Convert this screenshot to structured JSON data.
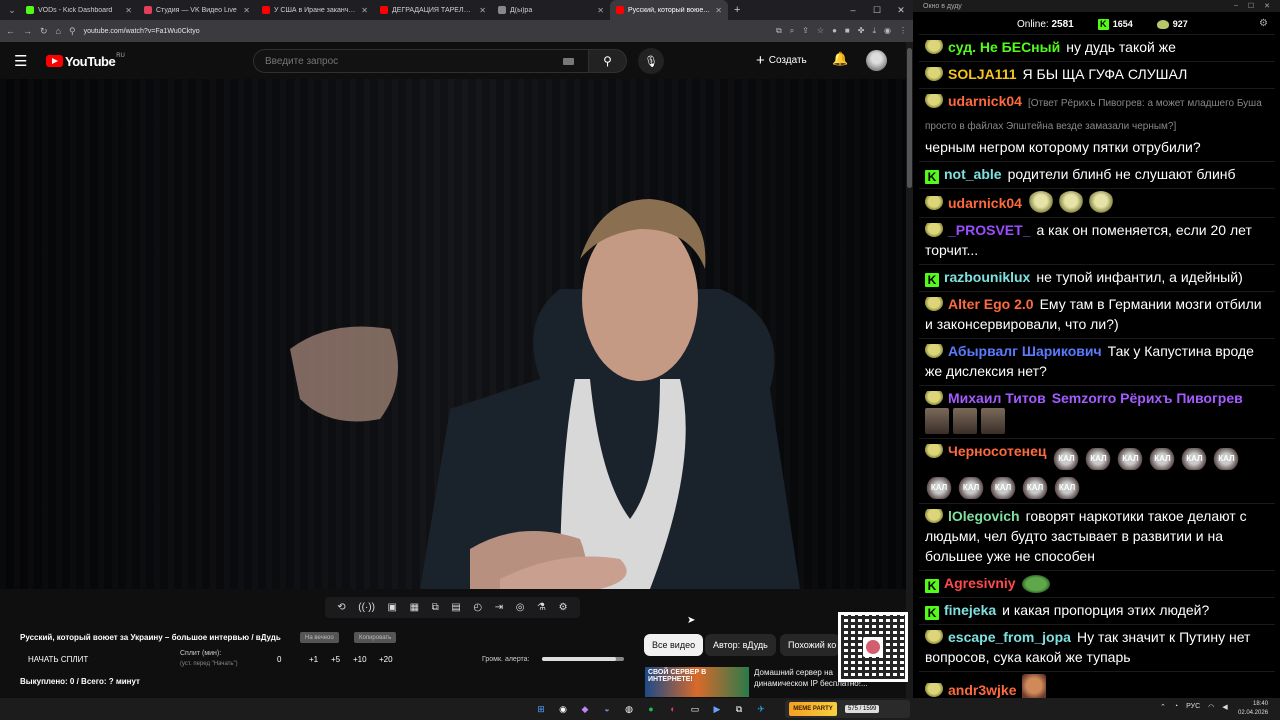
{
  "browser": {
    "tabs": [
      {
        "title": "VODs - Kick Dashboard",
        "fav": "#53fc18"
      },
      {
        "title": "Студия — VK Видео Live",
        "fav": "#e53d5b"
      },
      {
        "title": "У США в Иране заканчиваются",
        "fav": "#ff0000"
      },
      {
        "title": "ДЕГРАДАЦИЯ ТАРЕЛОЧНИЦ",
        "fav": "#ff0000"
      },
      {
        "title": "Д(ы)ра",
        "fav": "#888888"
      },
      {
        "title": "Русский, который воюет з",
        "fav": "#ff0000",
        "active": true
      }
    ],
    "url": "youtube.com/watch?v=Fa1Wu0Cktyo"
  },
  "youtube": {
    "logo": "YouTube",
    "region": "RU",
    "search_placeholder": "Введите запрос",
    "create": "Создать"
  },
  "panel": {
    "title": "Русский, который воюет за Украину – большое интервью / вДудь",
    "pill1": "На вечеоо",
    "pill2": "Копировать",
    "start_split": "НАЧАТЬ СПЛИТ",
    "split_label": "Сплит (мин):",
    "split_sub": "(уст. перед \"Начать\")",
    "split_buttons": [
      "0",
      "+1",
      "+5",
      "+10",
      "+20"
    ],
    "alert_label": "Громк. алерта:",
    "alert_volume": 0.9,
    "bought": "Выкуплено: 0 / Всего: ? минут"
  },
  "chips": [
    "Все видео",
    "Автор: вДудь",
    "Похожий ко"
  ],
  "ad": {
    "thumb_text": "СВОЙ СЕРВЕР В ИНТЕРНЕТЕ!",
    "text": "Домашний сервер на динамическом IP бесплатно!..."
  },
  "chat": {
    "window_title": "Окно в дуду",
    "online_label": "Online:",
    "online_count": "2581",
    "kick_count": "1654",
    "pepe_count": "927",
    "messages": [
      {
        "badge": "pepe",
        "name": "суд. Не БЕСный",
        "color": "#53fc18",
        "text": "ну дудь такой же"
      },
      {
        "badge": "pepe",
        "name": "SOLJA111",
        "color": "#f5c518",
        "text": "Я БЫ ЩА ГУФА СЛУШАЛ"
      },
      {
        "badge": "pepe",
        "name": "udarnick04",
        "color": "#ff6a3d",
        "reply": "[Ответ Рёрихъ Пивогрев: а может младшего Буша просто в файлах Эпштейна везде замазали черным?]",
        "text": "черным негром которому пятки отрубили?"
      },
      {
        "badge": "kick",
        "name": "not_able",
        "color": "#7fe0e0",
        "text": "родители блинб не слушают блинб"
      },
      {
        "badge": "pepe",
        "name": "udarnick04",
        "color": "#ff6a3d",
        "text": "",
        "emotes": [
          "pepe",
          "pepe",
          "pepe"
        ]
      },
      {
        "badge": "pepe",
        "name": "_PROSVET_",
        "color": "#9b4dff",
        "text": "а как он поменяется, если 20 лет торчит..."
      },
      {
        "badge": "kick",
        "name": "razbouniklux",
        "color": "#7fe0e0",
        "text": "не тупой инфантил, а идейный)"
      },
      {
        "badge": "pepe",
        "name": "Alter Ego 2.0",
        "color": "#ff6a3d",
        "text": "Ему там в Германии мозги отбили и законсервировали, что ли?)"
      },
      {
        "badge": "pepe",
        "name": "Абырвалг Шарикович",
        "color": "#5b7bff",
        "text": "Так у Капустина вроде же дислексия нет?"
      },
      {
        "badge": "pepe",
        "name": "Михаил Титов",
        "color": "#a45bff",
        "text": "Semzorro Рёрихъ Пивогрев",
        "text_color": "#a45bff",
        "emotes": [
          "pic",
          "pic",
          "pic"
        ]
      },
      {
        "badge": "pepe",
        "name": "Черносотенец",
        "color": "#ff6a3d",
        "text": "",
        "emotes": [
          "КАЛ",
          "КАЛ",
          "КАЛ",
          "КАЛ",
          "КАЛ",
          "КАЛ",
          "КАЛ",
          "КАЛ",
          "КАЛ",
          "КАЛ",
          "КАЛ"
        ]
      },
      {
        "badge": "pepe",
        "name": "lOlegovich",
        "color": "#7fe0a0",
        "text": "говорят наркотики такое делают с людьми, чел будто застывает в развитии и на большее уже не способен"
      },
      {
        "badge": "kick",
        "name": "Agresivniy",
        "color": "#ff4a4a",
        "text": "",
        "emotes": [
          "frog"
        ]
      },
      {
        "badge": "kick",
        "name": "finejeka",
        "color": "#7fe0e0",
        "text": "и какая пропорция этих людей?"
      },
      {
        "badge": "pepe",
        "name": "escape_from_jopa",
        "color": "#7fe0e0",
        "text": "Ну так значит к Путину нет вопросов, сука какой же тупарь"
      },
      {
        "badge": "pepe",
        "name": "andr3wjke",
        "color": "#ff6a3d",
        "text": "",
        "emotes": [
          "face"
        ]
      }
    ]
  },
  "taskbar": {
    "meme": "MEME PARTY",
    "count": "575 / 1599",
    "lang": "РУС",
    "time": "18:40",
    "date": "02.04.2026"
  }
}
